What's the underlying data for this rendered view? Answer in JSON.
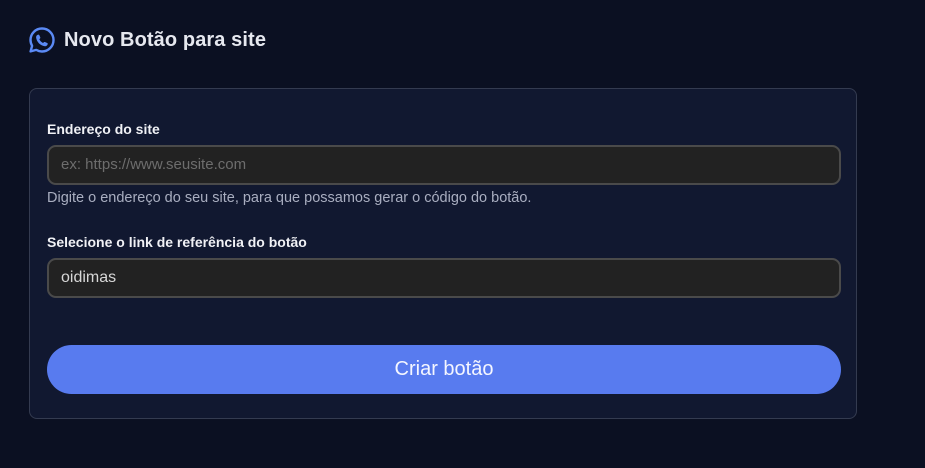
{
  "header": {
    "icon": "whatsapp-icon",
    "title": "Novo Botão para site"
  },
  "form": {
    "site_address": {
      "label": "Endereço do site",
      "placeholder": "ex: https://www.seusite.com",
      "value": "",
      "help": "Digite o endereço do seu site, para que possamos gerar o código do botão."
    },
    "reference_link": {
      "label": "Selecione o link de referência do botão",
      "value": "oidimas"
    },
    "submit_label": "Criar botão"
  },
  "colors": {
    "background": "#0b1022",
    "card": "#111830",
    "accent": "#587bef",
    "icon": "#5b8af5"
  }
}
